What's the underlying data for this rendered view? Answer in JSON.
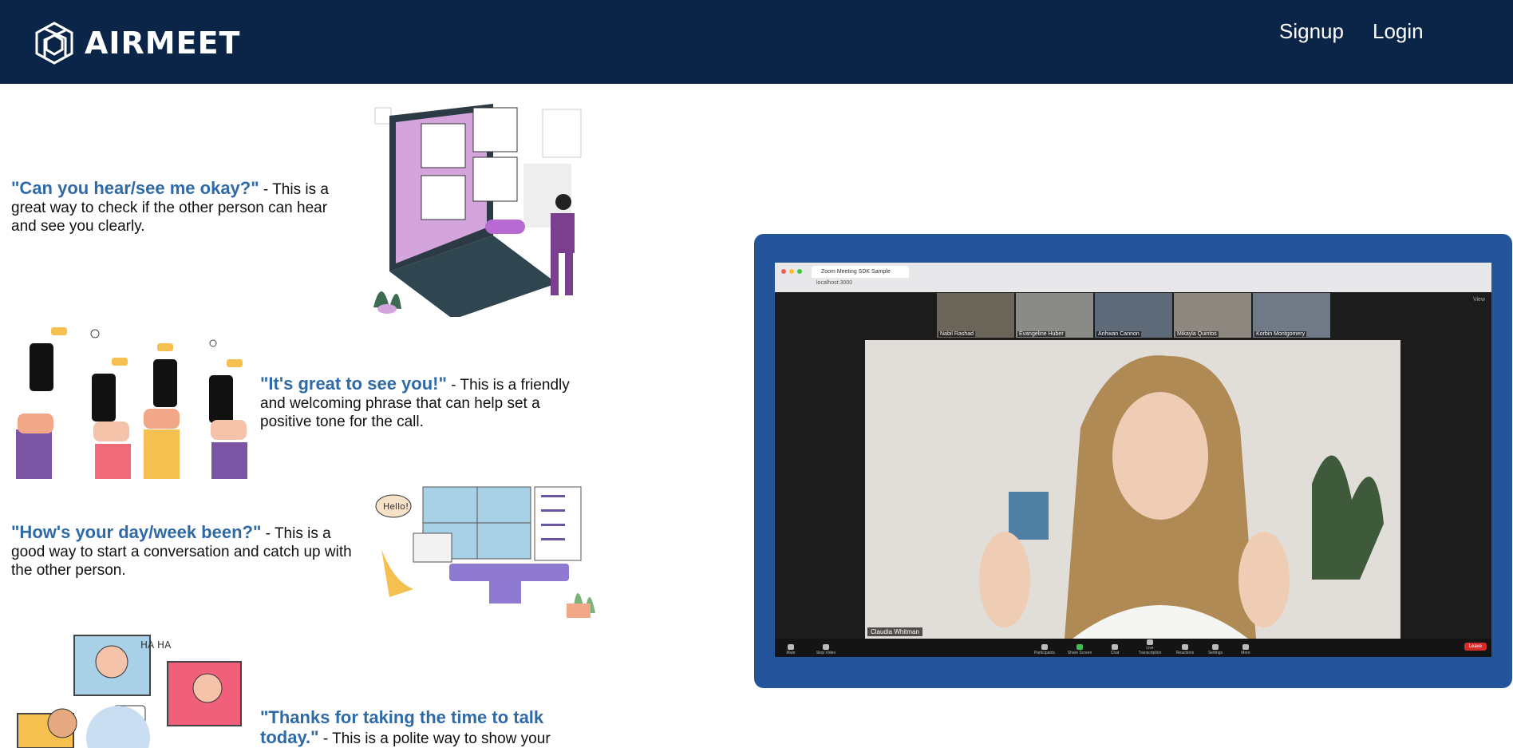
{
  "header": {
    "logo_text": "AIRMEET",
    "nav": {
      "signup": "Signup",
      "login": "Login"
    }
  },
  "tips": [
    {
      "phrase": "\"Can you hear/see me okay?\"",
      "description": " - This is a great way to check if the other person can hear and see you clearly."
    },
    {
      "phrase": "\"It's great to see you!\"",
      "description": " - This is a friendly and welcoming phrase that can help set a positive tone for the call."
    },
    {
      "phrase": "\"How's your day/week been?\"",
      "description": " - This is a good way to start a conversation and catch up with the other person."
    },
    {
      "phrase": "\"Thanks for taking the time to talk today.\"",
      "description": " - This is a polite way to show your"
    }
  ],
  "illustration_text": {
    "hello_bubble": "Hello!",
    "haha": "HA HA"
  },
  "meeting": {
    "tab_title": "Zoom Meeting SDK Sample",
    "url": "localhost:3000",
    "view_label": "View",
    "participants": [
      "Nabil Rashad",
      "Evangeline Huber",
      "Anhwan Cannon",
      "Mikayla Quintos",
      "Korbin Montgomery"
    ],
    "speaker": "Claudia Whitman",
    "toolbar": [
      "Mute",
      "Stop Video",
      "Participants",
      "Share Screen",
      "Chat",
      "Live Transcription",
      "Reactions",
      "Settings",
      "More"
    ],
    "leave_label": "Leave"
  },
  "colors": {
    "navbar": "#0b2548",
    "accent_text": "#2f6aa6",
    "panel": "#24549a"
  }
}
